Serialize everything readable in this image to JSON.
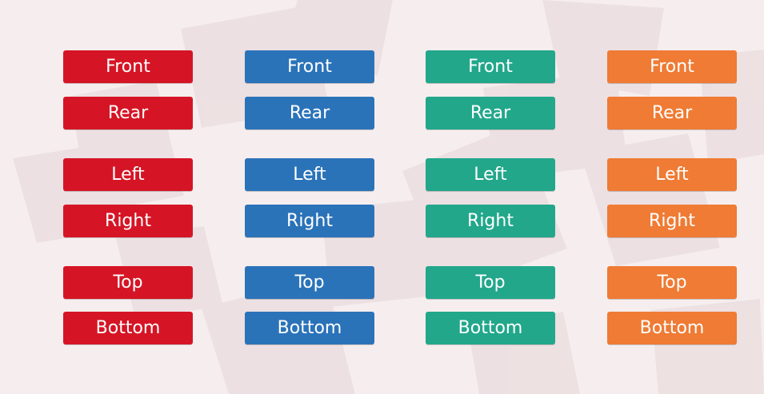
{
  "colors": {
    "red": "#d51525",
    "blue": "#2b73b9",
    "teal": "#22a78b",
    "orange": "#ef7b34",
    "background": "#f6eeee"
  },
  "columns": [
    {
      "color_key": "red",
      "buttons": [
        "Front",
        "Rear",
        "Left",
        "Right",
        "Top",
        "Bottom"
      ]
    },
    {
      "color_key": "blue",
      "buttons": [
        "Front",
        "Rear",
        "Left",
        "Right",
        "Top",
        "Bottom"
      ]
    },
    {
      "color_key": "teal",
      "buttons": [
        "Front",
        "Rear",
        "Left",
        "Right",
        "Top",
        "Bottom"
      ]
    },
    {
      "color_key": "orange",
      "buttons": [
        "Front",
        "Rear",
        "Left",
        "Right",
        "Top",
        "Bottom"
      ]
    }
  ]
}
